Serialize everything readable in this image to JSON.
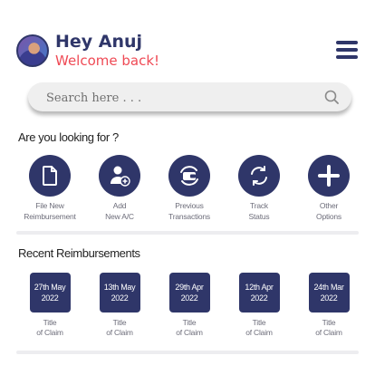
{
  "header": {
    "greeting": "Hey Anuj",
    "subtitle": "Welcome back!"
  },
  "search": {
    "placeholder": "Search here . . ."
  },
  "quick_actions": {
    "title": "Are you looking for ?",
    "items": [
      {
        "line1": "File New",
        "line2": "Reimbursement",
        "icon": "document-icon"
      },
      {
        "line1": "Add",
        "line2": "New A/C",
        "icon": "add-user-icon"
      },
      {
        "line1": "Previous",
        "line2": "Transactions",
        "icon": "wallet-history-icon"
      },
      {
        "line1": "Track",
        "line2": "Status",
        "icon": "refresh-icon"
      },
      {
        "line1": "Other",
        "line2": "Options",
        "icon": "plus-icon"
      }
    ]
  },
  "recent": {
    "title": "Recent Reimbursements",
    "items": [
      {
        "day": "27th May",
        "year": "2022",
        "line1": "Title",
        "line2": "of Claim"
      },
      {
        "day": "13th May",
        "year": "2022",
        "line1": "Title",
        "line2": "of Claim"
      },
      {
        "day": "29th Apr",
        "year": "2022",
        "line1": "Title",
        "line2": "of Claim"
      },
      {
        "day": "12th Apr",
        "year": "2022",
        "line1": "Title",
        "line2": "of Claim"
      },
      {
        "day": "24th Mar",
        "year": "2022",
        "line1": "Title",
        "line2": "of Claim"
      }
    ]
  },
  "colors": {
    "primary": "#2f3669",
    "accent": "#ef4a55",
    "muted_text": "#6d6d7a"
  }
}
